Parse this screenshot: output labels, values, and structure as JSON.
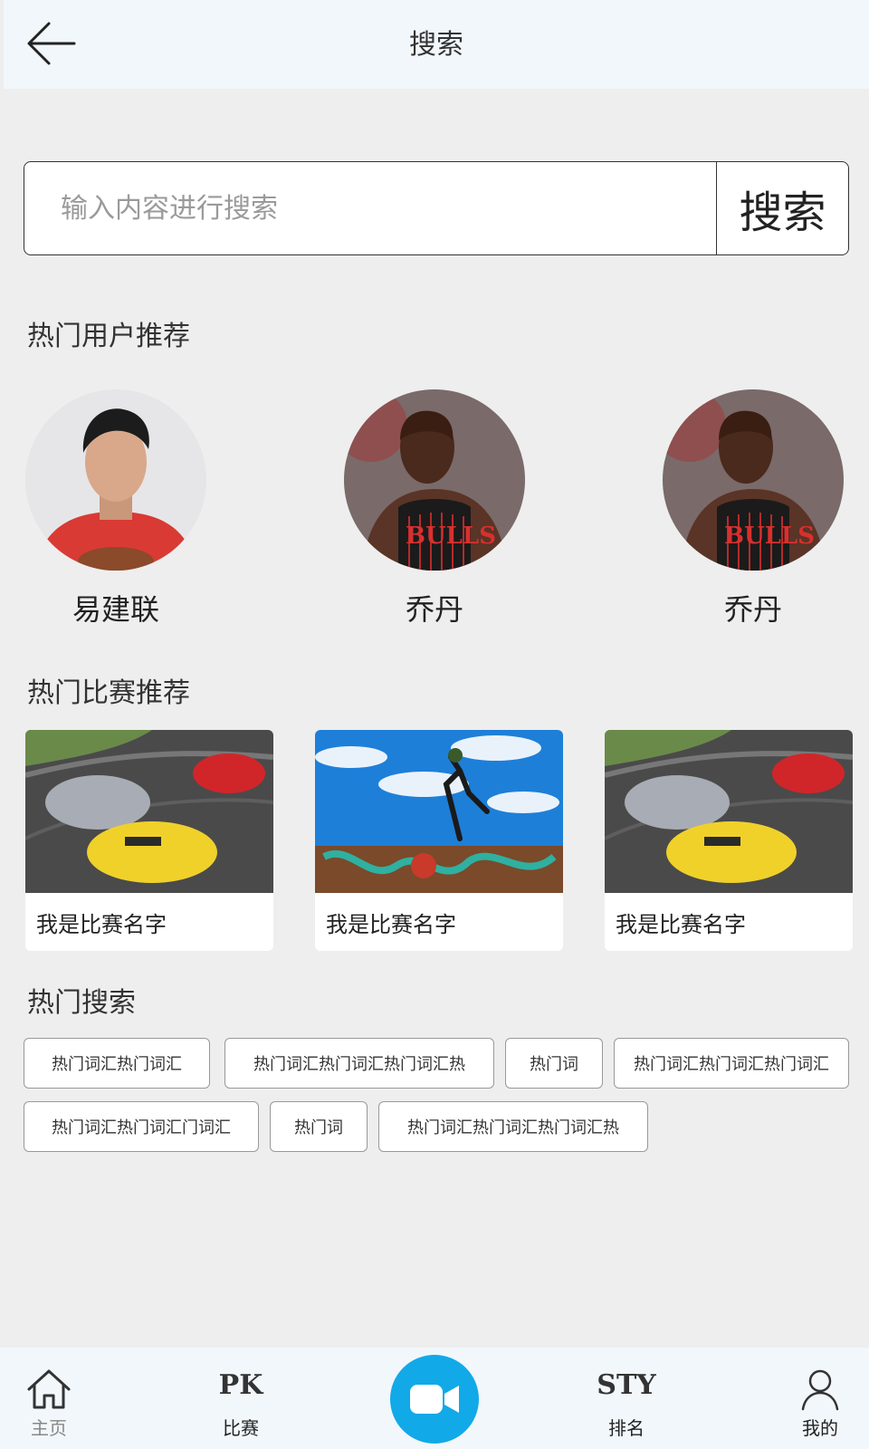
{
  "header": {
    "title": "搜索",
    "back_icon": "arrow-left-icon"
  },
  "search": {
    "placeholder": "输入内容进行搜索",
    "button_label": "搜索"
  },
  "sections": {
    "hot_users_title": "热门用户推荐",
    "hot_matches_title": "热门比赛推荐",
    "hot_search_title": "热门搜索"
  },
  "hot_users": [
    {
      "name": "易建联"
    },
    {
      "name": "乔丹"
    },
    {
      "name": "乔丹"
    }
  ],
  "hot_matches": [
    {
      "name": "我是比赛名字",
      "image": "racing-cars"
    },
    {
      "name": "我是比赛名字",
      "image": "street-dancer"
    },
    {
      "name": "我是比赛名字",
      "image": "racing-cars"
    }
  ],
  "hot_tags": [
    "热门词汇热门词汇",
    "热门词汇热门词汇热门词汇热",
    "热门词",
    "热门词汇热门词汇热门词汇",
    "热门词汇热门词汇门词汇",
    "热门词",
    "热门词汇热门词汇热门词汇热"
  ],
  "tabbar": {
    "items": [
      {
        "label": "主页",
        "icon": "home-icon",
        "active": false
      },
      {
        "label": "比赛",
        "icon_text": "PK",
        "icon": "pk-text-icon"
      },
      {
        "label": "",
        "icon": "video-camera-icon"
      },
      {
        "label": "排名",
        "icon_text": "STY",
        "icon": "sty-text-icon"
      },
      {
        "label": "我的",
        "icon": "user-icon"
      }
    ]
  },
  "colors": {
    "accent": "#12a9e8",
    "header_bg": "#f1f7fb",
    "page_bg": "#eeeeee"
  }
}
